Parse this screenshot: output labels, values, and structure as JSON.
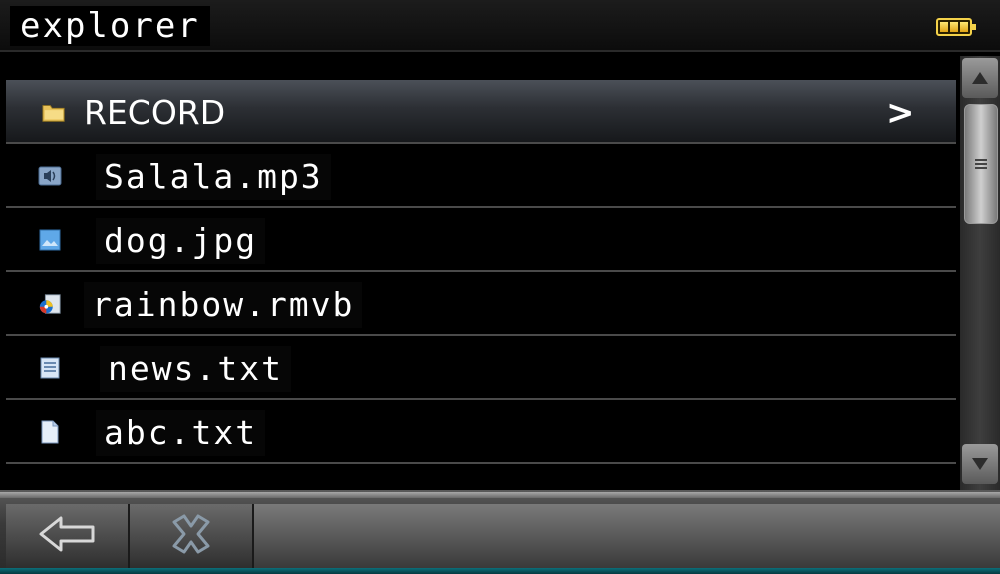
{
  "app": {
    "title": "explorer"
  },
  "status": {
    "battery_icon": "battery-full-icon",
    "battery_color": "#f4d24a"
  },
  "files": [
    {
      "name": "RECORD",
      "type": "folder",
      "icon": "folder-icon",
      "selected": true,
      "chevron": ">"
    },
    {
      "name": "Salala.mp3",
      "type": "audio",
      "icon": "audio-file-icon",
      "selected": false
    },
    {
      "name": "dog.jpg",
      "type": "image",
      "icon": "image-file-icon",
      "selected": false
    },
    {
      "name": "rainbow.rmvb",
      "type": "video",
      "icon": "video-file-icon",
      "selected": false
    },
    {
      "name": "news.txt",
      "type": "text",
      "icon": "text-file-icon",
      "selected": false
    },
    {
      "name": "abc.txt",
      "type": "text",
      "icon": "text-file-icon",
      "selected": false
    }
  ],
  "scrollbar": {
    "up_icon": "scroll-up-arrow-icon",
    "down_icon": "scroll-down-arrow-icon"
  },
  "toolbar": {
    "back_icon": "back-arrow-icon",
    "close_icon": "close-x-icon"
  }
}
